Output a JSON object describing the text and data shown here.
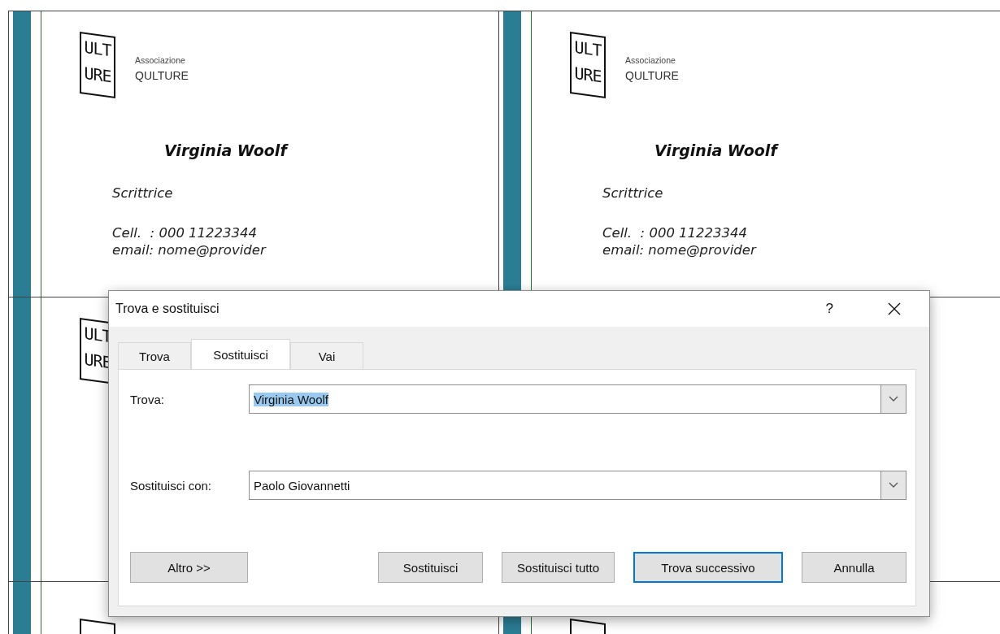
{
  "document": {
    "cards": [
      {
        "kind": "full",
        "logo_text": "ULT URE",
        "association_label": "Associazione",
        "association_name": "QULTURE",
        "name": "Virginia Woolf",
        "role": "Scrittrice",
        "phone": "Cell.  : 000 11223344",
        "email": "email: nome@provider"
      },
      {
        "kind": "full",
        "logo_text": "ULT URE",
        "association_label": "Associazione",
        "association_name": "QULTURE",
        "name": "Virginia Woolf",
        "role": "Scrittrice",
        "phone": "Cell.  : 000 11223344",
        "email": "email: nome@provider"
      },
      {
        "kind": "logo",
        "logo_text": "ULT URE"
      },
      {
        "kind": "blank"
      },
      {
        "kind": "logo_frame"
      },
      {
        "kind": "logo_frame"
      }
    ]
  },
  "dialog": {
    "title": "Trova e sostituisci",
    "help_label": "?",
    "tabs": [
      {
        "label": "Trova",
        "selected": false
      },
      {
        "label": "Sostituisci",
        "selected": true
      },
      {
        "label": "Vai",
        "selected": false
      }
    ],
    "fields": [
      {
        "label": "Trova:",
        "value": "Virginia Woolf",
        "text_selected": true
      },
      {
        "label": "Sostituisci con:",
        "value": "Paolo Giovannetti",
        "text_selected": false
      }
    ],
    "buttons": [
      {
        "label": "Altro >>",
        "default": false
      },
      {
        "label": "Sostituisci",
        "default": false
      },
      {
        "label": "Sostituisci tutto",
        "default": false
      },
      {
        "label": "Trova successivo",
        "default": true
      },
      {
        "label": "Annulla",
        "default": false
      }
    ]
  }
}
